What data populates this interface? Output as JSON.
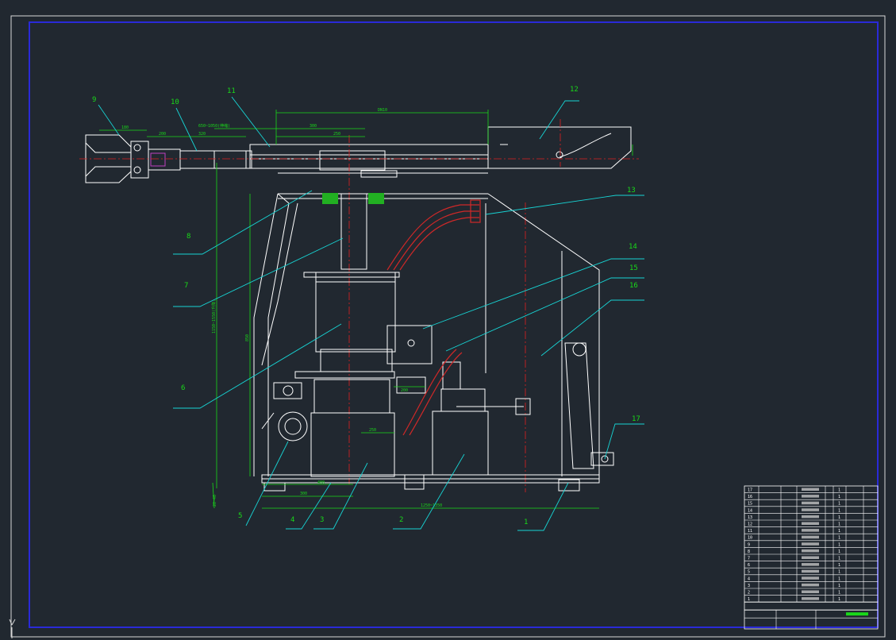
{
  "theme": {
    "background": "#212830",
    "sheet_border": "#d8d8d8",
    "frame": "#2a2ad8",
    "outline": "#ffffff",
    "leader": "#17d4d4",
    "dimension": "#19d919",
    "centerline": "#e02020",
    "hydraulic": "#d02828",
    "valve": "#22b022",
    "hatch": "#c040c0"
  },
  "icons": {
    "ucs": "ucs-y-axis-icon"
  },
  "ucs_label": "Y",
  "callouts": [
    "1",
    "2",
    "3",
    "4",
    "5",
    "6",
    "7",
    "8",
    "9",
    "10",
    "11",
    "12",
    "13",
    "14",
    "15",
    "16",
    "17"
  ],
  "dims": {
    "top_stroke": "DN10",
    "stroke_range": "650~1050(伸缩)",
    "d1": "300",
    "d2": "250",
    "d3": "180",
    "d4": "200",
    "d5": "320",
    "height_range": "1150~1550(升降)",
    "body_h": "850",
    "base_w": "1250~1350",
    "base_a": "300",
    "base_b": "400",
    "ground": "20~40",
    "small_a": "250",
    "small_b": "200"
  },
  "title_block": {
    "rows": [
      {
        "no": "17",
        "code": "",
        "name": "",
        "qty": "1"
      },
      {
        "no": "16",
        "code": "",
        "name": "",
        "qty": "1"
      },
      {
        "no": "15",
        "code": "",
        "name": "",
        "qty": "1"
      },
      {
        "no": "14",
        "code": "",
        "name": "",
        "qty": "1"
      },
      {
        "no": "13",
        "code": "",
        "name": "",
        "qty": "1"
      },
      {
        "no": "12",
        "code": "",
        "name": "",
        "qty": "1"
      },
      {
        "no": "11",
        "code": "",
        "name": "",
        "qty": "1"
      },
      {
        "no": "10",
        "code": "",
        "name": "",
        "qty": "1"
      },
      {
        "no": "9",
        "code": "",
        "name": "",
        "qty": "1"
      },
      {
        "no": "8",
        "code": "",
        "name": "",
        "qty": "1"
      },
      {
        "no": "7",
        "code": "",
        "name": "",
        "qty": "1"
      },
      {
        "no": "6",
        "code": "",
        "name": "",
        "qty": "1"
      },
      {
        "no": "5",
        "code": "",
        "name": "",
        "qty": "1"
      },
      {
        "no": "4",
        "code": "",
        "name": "",
        "qty": "1"
      },
      {
        "no": "3",
        "code": "",
        "name": "",
        "qty": "1"
      },
      {
        "no": "2",
        "code": "",
        "name": "",
        "qty": "1"
      },
      {
        "no": "1",
        "code": "",
        "name": "",
        "qty": "1"
      }
    ]
  }
}
